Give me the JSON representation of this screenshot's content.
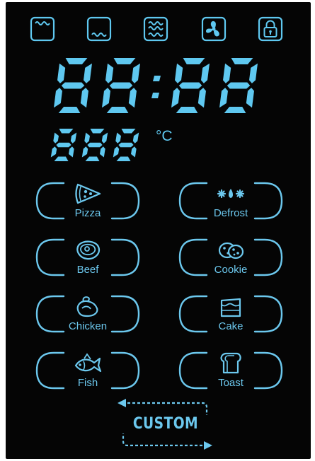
{
  "display": {
    "clock_digits": [
      "8",
      "8",
      "8",
      "8"
    ],
    "clock_separator": ":",
    "temp_digits": [
      "8",
      "8",
      "8"
    ],
    "temp_unit": "°C"
  },
  "top_icons": [
    {
      "name": "top-heat-icon"
    },
    {
      "name": "bottom-heat-icon"
    },
    {
      "name": "top-bottom-heat-icon"
    },
    {
      "name": "fan-icon"
    },
    {
      "name": "lock-icon"
    }
  ],
  "foods": [
    {
      "label": "Pizza",
      "icon": "pizza-icon"
    },
    {
      "label": "Defrost",
      "icon": "defrost-icon"
    },
    {
      "label": "Beef",
      "icon": "beef-icon"
    },
    {
      "label": "Cookie",
      "icon": "cookie-icon"
    },
    {
      "label": "Chicken",
      "icon": "chicken-icon"
    },
    {
      "label": "Cake",
      "icon": "cake-icon"
    },
    {
      "label": "Fish",
      "icon": "fish-icon"
    },
    {
      "label": "Toast",
      "icon": "toast-icon"
    }
  ],
  "custom": {
    "label": "CUSTOM"
  },
  "colors": {
    "accent": "#6cc8ee",
    "background": "#050505"
  }
}
